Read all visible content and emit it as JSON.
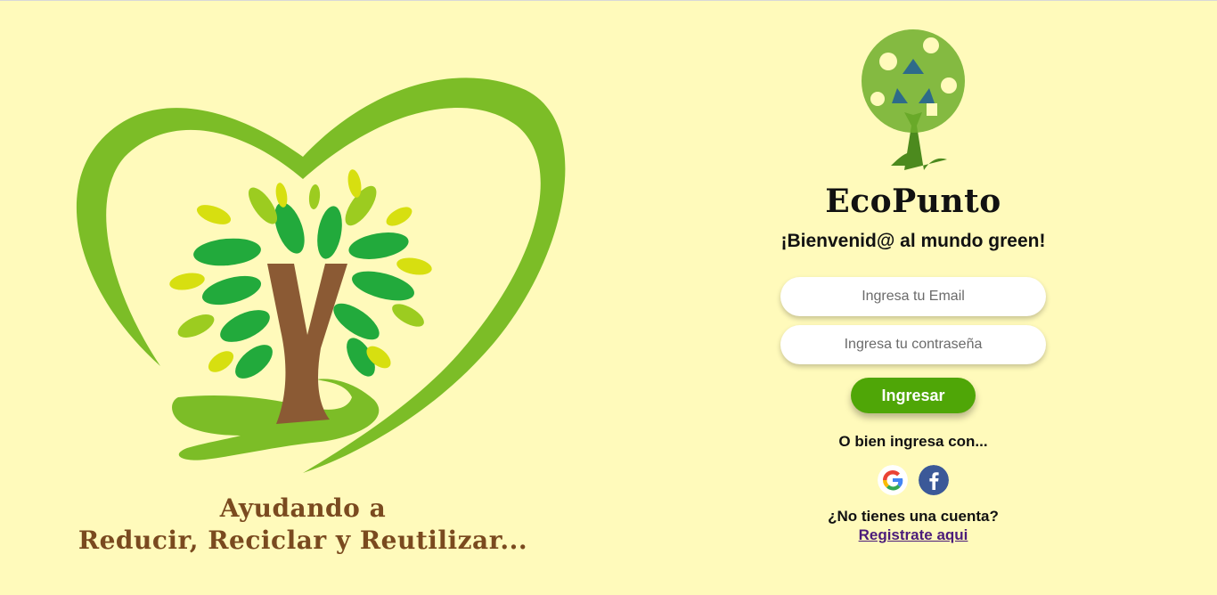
{
  "hero": {
    "tagline_line1": "Ayudando a",
    "tagline_line2": "Reducir, Reciclar y Reutilizar..."
  },
  "login": {
    "brand": "EcoPunto",
    "welcome": "¡Bienvenid@ al mundo green!",
    "email_placeholder": "Ingresa tu Email",
    "password_placeholder": "Ingresa tu contraseña",
    "submit_label": "Ingresar",
    "alt_login_text": "O bien ingresa con...",
    "no_account_text": "¿No tienes una cuenta?",
    "register_link": "Registrate aqui"
  },
  "icons": {
    "google": "google-icon",
    "facebook": "facebook-icon"
  },
  "colors": {
    "background": "#fffabb",
    "primary_green": "#4fa607",
    "heart_green": "#7cbd27",
    "trunk_brown": "#8b5a34",
    "tagline_brown": "#7a4a1f",
    "link_purple": "#4b1c7a"
  }
}
